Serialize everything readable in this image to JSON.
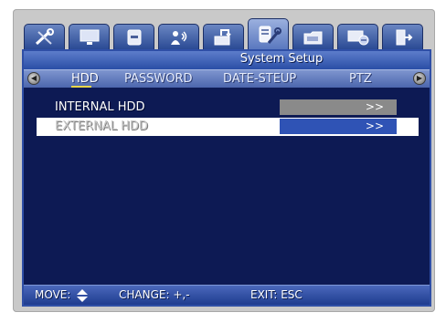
{
  "tabs": [
    {
      "icon": "tools-icon"
    },
    {
      "icon": "monitor-icon"
    },
    {
      "icon": "hdd-icon"
    },
    {
      "icon": "camera-person-icon"
    },
    {
      "icon": "record-icon"
    },
    {
      "icon": "system-setup-icon",
      "active": true
    },
    {
      "icon": "folder-icon"
    },
    {
      "icon": "network-icon"
    },
    {
      "icon": "exit-icon"
    }
  ],
  "title": "System Setup",
  "subtabs": [
    {
      "label": "HDD",
      "active": true
    },
    {
      "label": "PASSWORD"
    },
    {
      "label": "DATE-STEUP"
    },
    {
      "label": "PTZ"
    }
  ],
  "rows": [
    {
      "label": "INTERNAL HDD",
      "button": ">>"
    },
    {
      "label": "EXTERNAL HDD",
      "button": ">>",
      "selected": true
    }
  ],
  "status": {
    "move": "MOVE:",
    "move_icon": "up-down-arrow-icon",
    "change": "CHANGE: +,-",
    "exit": "EXIT: ESC"
  }
}
